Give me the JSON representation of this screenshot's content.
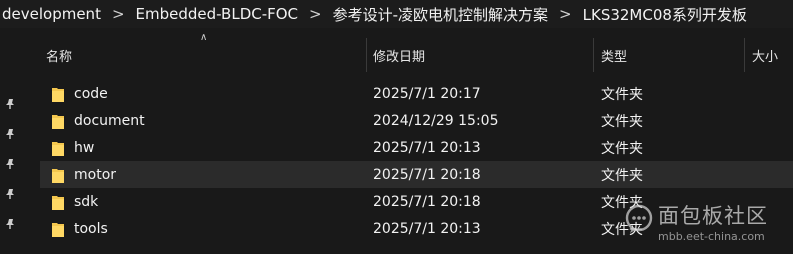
{
  "breadcrumb": [
    "development",
    "Embedded-BLDC-FOC",
    "参考设计-凌欧电机控制解决方案",
    "LKS32MC08系列开发板"
  ],
  "columns": {
    "name": "名称",
    "modified": "修改日期",
    "type": "类型",
    "size": "大小"
  },
  "files": [
    {
      "name": "code",
      "modified": "2025/7/1 20:17",
      "type": "文件夹"
    },
    {
      "name": "document",
      "modified": "2024/12/29 15:05",
      "type": "文件夹"
    },
    {
      "name": "hw",
      "modified": "2025/7/1 20:13",
      "type": "文件夹"
    },
    {
      "name": "motor",
      "modified": "2025/7/1 20:18",
      "type": "文件夹"
    },
    {
      "name": "sdk",
      "modified": "2025/7/1 20:18",
      "type": "文件夹"
    },
    {
      "name": "tools",
      "modified": "2025/7/1 20:13",
      "type": "文件夹"
    }
  ],
  "hovered_row": "motor",
  "watermark": {
    "title": "面包板社区",
    "url": "mbb.eet-china.com"
  },
  "colors": {
    "background": "#191919",
    "folder": "#f4c74e",
    "hover": "#2b2b2b",
    "text": "#f2f2f2"
  },
  "icons": {
    "folder": "folder-icon",
    "pin": "pin-icon",
    "chevron": "chevron-right-icon",
    "sort": "sort-up-icon"
  }
}
